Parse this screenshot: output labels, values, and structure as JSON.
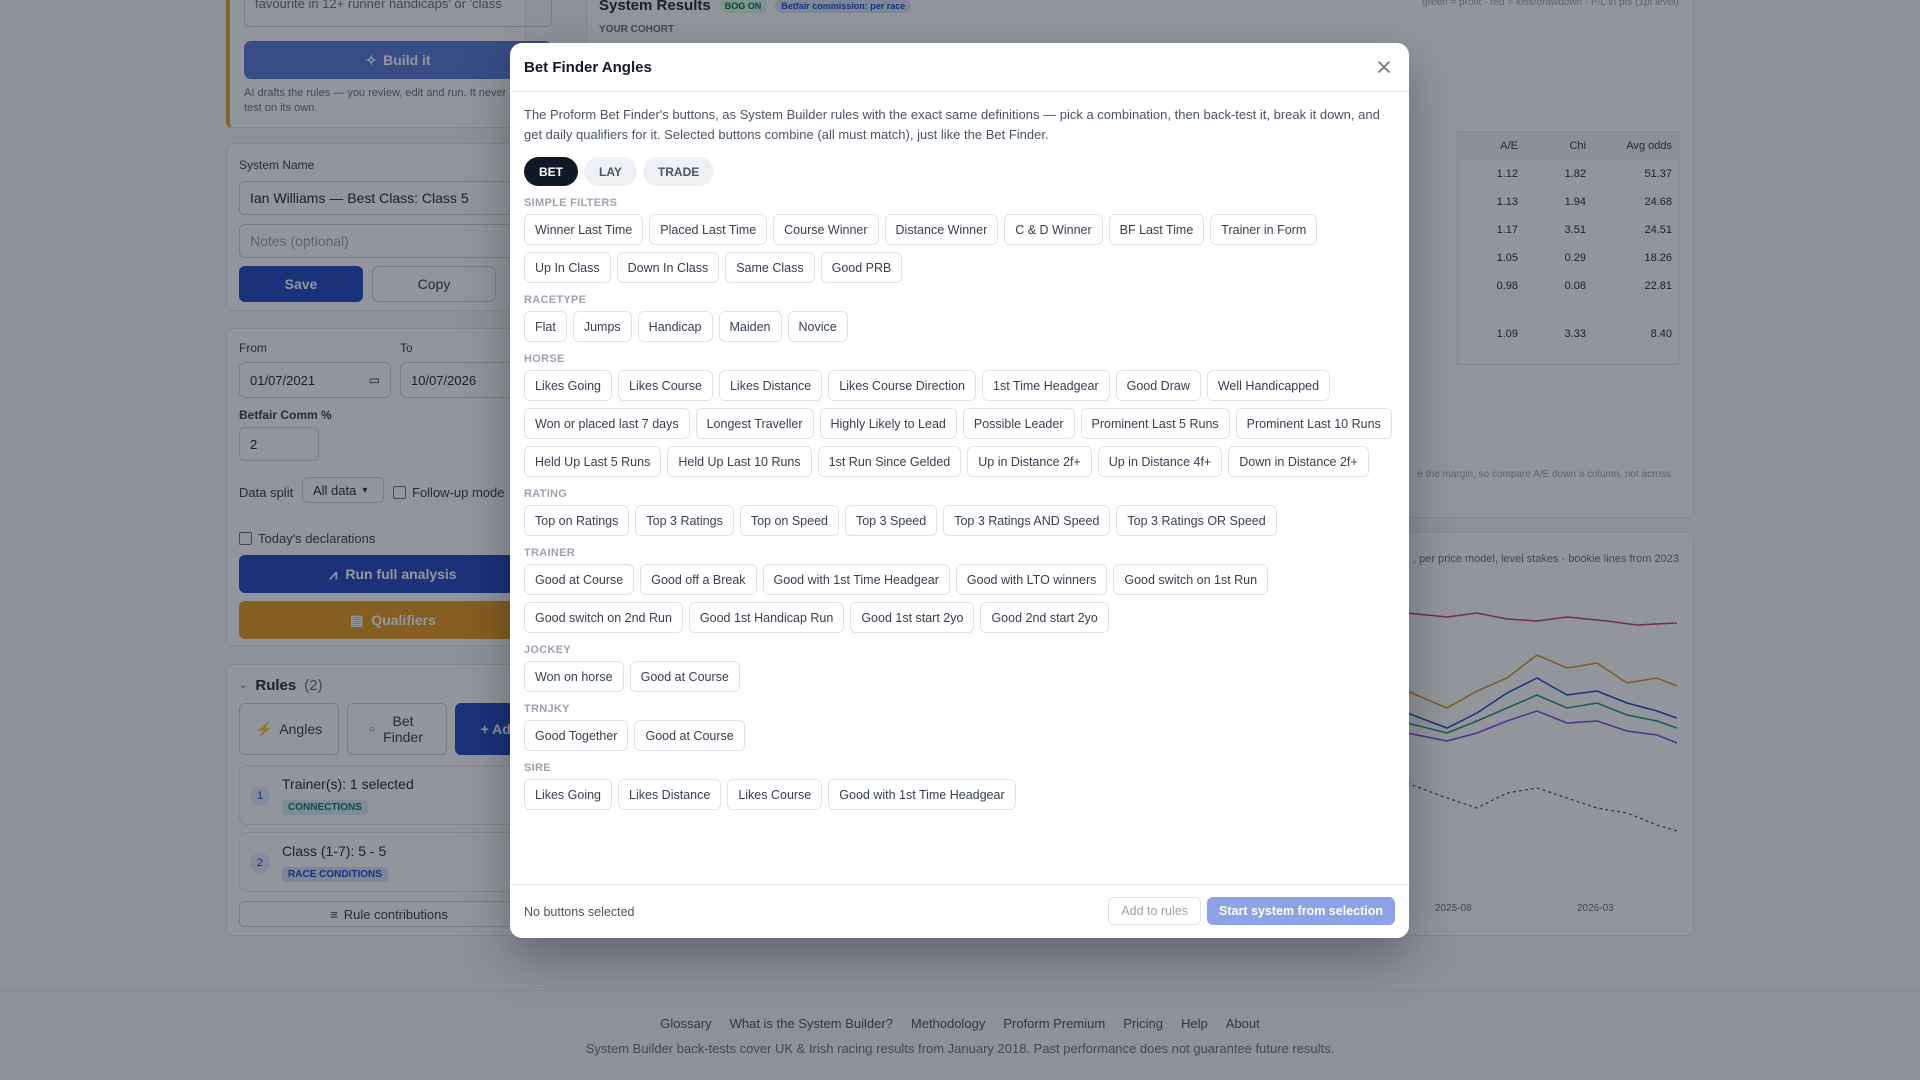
{
  "background": {
    "ai_card": {
      "prompt_text": "favourite in 12+ runner handicaps' or 'class",
      "build_label": "Build it",
      "note": "AI drafts the rules — you review, edit and run. It never r back-test on its own."
    },
    "system": {
      "name_label": "System Name",
      "name_value": "Ian Williams — Best Class: Class 5",
      "notes_placeholder": "Notes (optional)",
      "save_label": "Save",
      "copy_label": "Copy"
    },
    "filters": {
      "from_label": "From",
      "from_value": "01/07/2021",
      "to_label": "To",
      "to_value": "10/07/2026",
      "comm_label": "Betfair Comm %",
      "comm_value": "2",
      "split_label": "Data split",
      "split_value": "All data",
      "followup_label": "Follow-up mode",
      "declarations_label": "Today's declarations",
      "run_label": "Run full analysis",
      "qualifiers_label": "Qualifiers"
    },
    "rules": {
      "title": "Rules",
      "count": "(2)",
      "angles_label": "Angles",
      "betfinder_label": "Bet Finder",
      "add_label": "+ Add",
      "items": [
        {
          "num": "1",
          "title": "Trainer(s): 1 selected",
          "tag": "CONNECTIONS"
        },
        {
          "num": "2",
          "title": "Class (1-7): 5 - 5",
          "tag": "RACE CONDITIONS"
        }
      ],
      "contrib_label": "Rule contributions"
    },
    "results": {
      "title": "System Results",
      "badge1": "BOG ON",
      "badge2": "Betfair commission: per race",
      "cohort": "YOUR COHORT",
      "legend_note": "green = profit · red = loss/drawdown · P/L in pts (1pt level)",
      "col_headers": [
        "A/E",
        "Chi",
        "Avg odds"
      ],
      "rows": [
        [
          "1.12",
          "1.82",
          "51.37"
        ],
        [
          "1.13",
          "1.94",
          "24.68"
        ],
        [
          "1.17",
          "3.51",
          "24.51"
        ],
        [
          "1.05",
          "0.29",
          "18.26"
        ],
        [
          "0.98",
          "0.08",
          "22.81"
        ],
        [
          "1.09",
          "3.33",
          "8.40"
        ]
      ],
      "margin_note": "e the margin, so compare A/E down a column, not across"
    },
    "chart": {
      "note": ", per price model, level stakes · bookie lines from 2023",
      "x_ticks": [
        "2025-08",
        "2026-03"
      ]
    },
    "footer": {
      "links": [
        "Glossary",
        "What is the System Builder?",
        "Methodology",
        "Proform Premium",
        "Pricing",
        "Help",
        "About"
      ],
      "note": "System Builder back-tests cover UK & Irish racing results from January 2018. Past performance does not guarantee future results."
    }
  },
  "modal": {
    "title": "Bet Finder Angles",
    "intro": "The Proform Bet Finder's buttons, as System Builder rules with the exact same definitions — pick a combination, then back-test it, break it down, and get daily qualifiers for it. Selected buttons combine (all must match), just like the Bet Finder.",
    "modes": [
      "BET",
      "LAY",
      "TRADE"
    ],
    "active_mode": "BET",
    "sections": [
      {
        "title": "Simple Filters",
        "chips": [
          "Winner Last Time",
          "Placed Last Time",
          "Course Winner",
          "Distance Winner",
          "C & D Winner",
          "BF Last Time",
          "Trainer in Form",
          "Up In Class",
          "Down In Class",
          "Same Class",
          "Good PRB"
        ]
      },
      {
        "title": "Racetype",
        "chips": [
          "Flat",
          "Jumps",
          "Handicap",
          "Maiden",
          "Novice"
        ]
      },
      {
        "title": "Horse",
        "chips": [
          "Likes Going",
          "Likes Course",
          "Likes Distance",
          "Likes Course Direction",
          "1st Time Headgear",
          "Good Draw",
          "Well Handicapped",
          "Won or placed last 7 days",
          "Longest Traveller",
          "Highly Likely to Lead",
          "Possible Leader",
          "Prominent Last 5 Runs",
          "Prominent Last 10 Runs",
          "Held Up Last 5 Runs",
          "Held Up Last 10 Runs",
          "1st Run Since Gelded",
          "Up in Distance 2f+",
          "Up in Distance 4f+",
          "Down in Distance 2f+"
        ]
      },
      {
        "title": "Rating",
        "chips": [
          "Top on Ratings",
          "Top 3 Ratings",
          "Top on Speed",
          "Top 3 Speed",
          "Top 3 Ratings AND Speed",
          "Top 3 Ratings OR Speed"
        ]
      },
      {
        "title": "Trainer",
        "chips": [
          "Good at Course",
          "Good off a Break",
          "Good with 1st Time Headgear",
          "Good with LTO winners",
          "Good switch on 1st Run",
          "Good switch on 2nd Run",
          "Good 1st Handicap Run",
          "Good 1st start 2yo",
          "Good 2nd start 2yo"
        ]
      },
      {
        "title": "Jockey",
        "chips": [
          "Won on horse",
          "Good at Course"
        ]
      },
      {
        "title": "Trnjky",
        "chips": [
          "Good Together",
          "Good at Course"
        ]
      },
      {
        "title": "Sire",
        "chips": [
          "Likes Going",
          "Likes Distance",
          "Likes Course",
          "Good with 1st Time Headgear"
        ]
      }
    ],
    "footer": {
      "status": "No buttons selected",
      "add_label": "Add to rules",
      "start_label": "Start system from selection"
    }
  }
}
